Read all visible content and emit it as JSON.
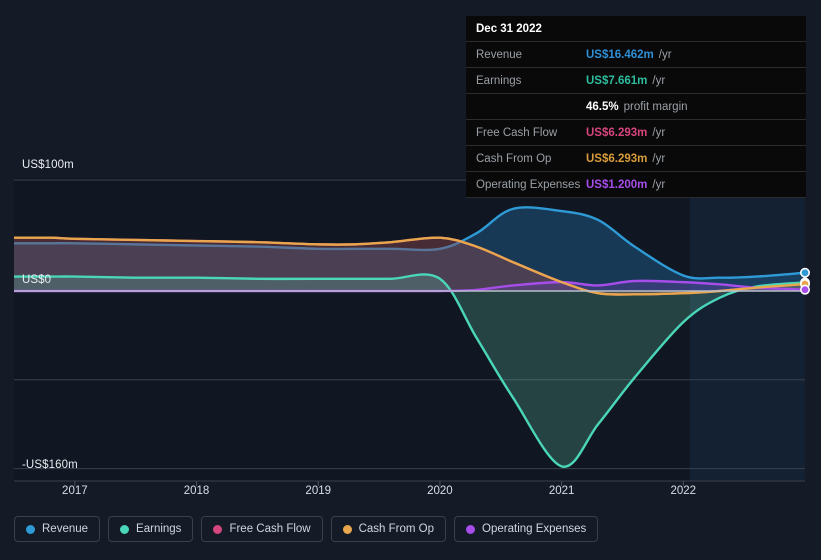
{
  "tooltip": {
    "title": "Dec 31 2022",
    "rows": [
      {
        "label": "Revenue",
        "value": "US$16.462m",
        "unit": "/yr",
        "color": "#2e8fd6"
      },
      {
        "label": "Earnings",
        "value": "US$7.661m",
        "unit": "/yr",
        "color": "#2ebd9e"
      },
      {
        "label": "",
        "value": "46.5%",
        "unit": "profit margin",
        "color": "#ffffff",
        "sub": true
      },
      {
        "label": "Free Cash Flow",
        "value": "US$6.293m",
        "unit": "/yr",
        "color": "#d6457e"
      },
      {
        "label": "Cash From Op",
        "value": "US$6.293m",
        "unit": "/yr",
        "color": "#d99c3a"
      },
      {
        "label": "Operating Expenses",
        "value": "US$1.200m",
        "unit": "/yr",
        "color": "#a64dea"
      }
    ]
  },
  "axes": {
    "y_top_label": "US$100m",
    "y_zero_label": "US$0",
    "y_bottom_label": "-US$160m",
    "x_ticks": [
      "2017",
      "2018",
      "2019",
      "2020",
      "2021",
      "2022"
    ]
  },
  "legend": {
    "items": [
      {
        "label": "Revenue",
        "color": "#2e9bd6"
      },
      {
        "label": "Earnings",
        "color": "#4ad6b8"
      },
      {
        "label": "Free Cash Flow",
        "color": "#d6467e"
      },
      {
        "label": "Cash From Op",
        "color": "#e8a64d"
      },
      {
        "label": "Operating Expenses",
        "color": "#a64dea"
      }
    ]
  },
  "chart_data": {
    "type": "area",
    "title": "",
    "xlabel": "",
    "ylabel": "US$",
    "ylim": [
      -160,
      100
    ],
    "xlim": [
      2016.5,
      2023.0
    ],
    "grid": true,
    "gridlines_y": [
      100,
      0,
      -80,
      -160
    ],
    "legend_position": "bottom-left",
    "x": [
      2016.5,
      2016.8,
      2017.0,
      2017.5,
      2018.0,
      2018.5,
      2019.0,
      2019.3,
      2019.6,
      2020.0,
      2020.3,
      2020.6,
      2021.0,
      2021.3,
      2021.6,
      2022.0,
      2022.3,
      2022.6,
      2023.0
    ],
    "series": [
      {
        "name": "Revenue",
        "color": "#2e9bd6",
        "fill": "rgba(33,100,150,0.45)",
        "values": [
          43,
          43,
          43,
          42,
          41,
          40,
          38,
          38,
          38,
          38,
          52,
          74,
          72,
          64,
          40,
          14,
          12,
          13,
          16.462
        ]
      },
      {
        "name": "Earnings",
        "color": "#4ad6b8",
        "fill": "rgba(90,170,150,0.30)",
        "values": [
          13,
          13,
          13,
          12,
          12,
          11,
          11,
          11,
          11,
          11,
          -42,
          -96,
          -158,
          -120,
          -78,
          -28,
          -6,
          4,
          7.661
        ]
      },
      {
        "name": "Free Cash Flow",
        "color": "#d6467e",
        "fill": "rgba(140,70,80,0.45)",
        "values": [
          48,
          48,
          47,
          46,
          45,
          44,
          42,
          42,
          44,
          48,
          40,
          26,
          8,
          -2,
          -3,
          -2,
          0,
          3,
          6.293
        ]
      },
      {
        "name": "Cash From Op",
        "color": "#e8a64d",
        "fill": "rgba(140,70,80,0.0)",
        "values": [
          48,
          48,
          47,
          46,
          45,
          44,
          42,
          42,
          44,
          48,
          40,
          26,
          8,
          -2,
          -3,
          -2,
          0,
          3,
          6.293
        ]
      },
      {
        "name": "Operating Expenses",
        "color": "#a64dea",
        "fill": "rgba(110,70,180,0.35)",
        "values": [
          0,
          0,
          0,
          0,
          0,
          0,
          0,
          0,
          0,
          0,
          1,
          5,
          8,
          5,
          9,
          8,
          6,
          3,
          1.2
        ]
      }
    ],
    "endpoint_markers": [
      "Revenue",
      "Earnings",
      "Cash From Op",
      "Operating Expenses"
    ],
    "forecast_band_start": 2022.0
  }
}
